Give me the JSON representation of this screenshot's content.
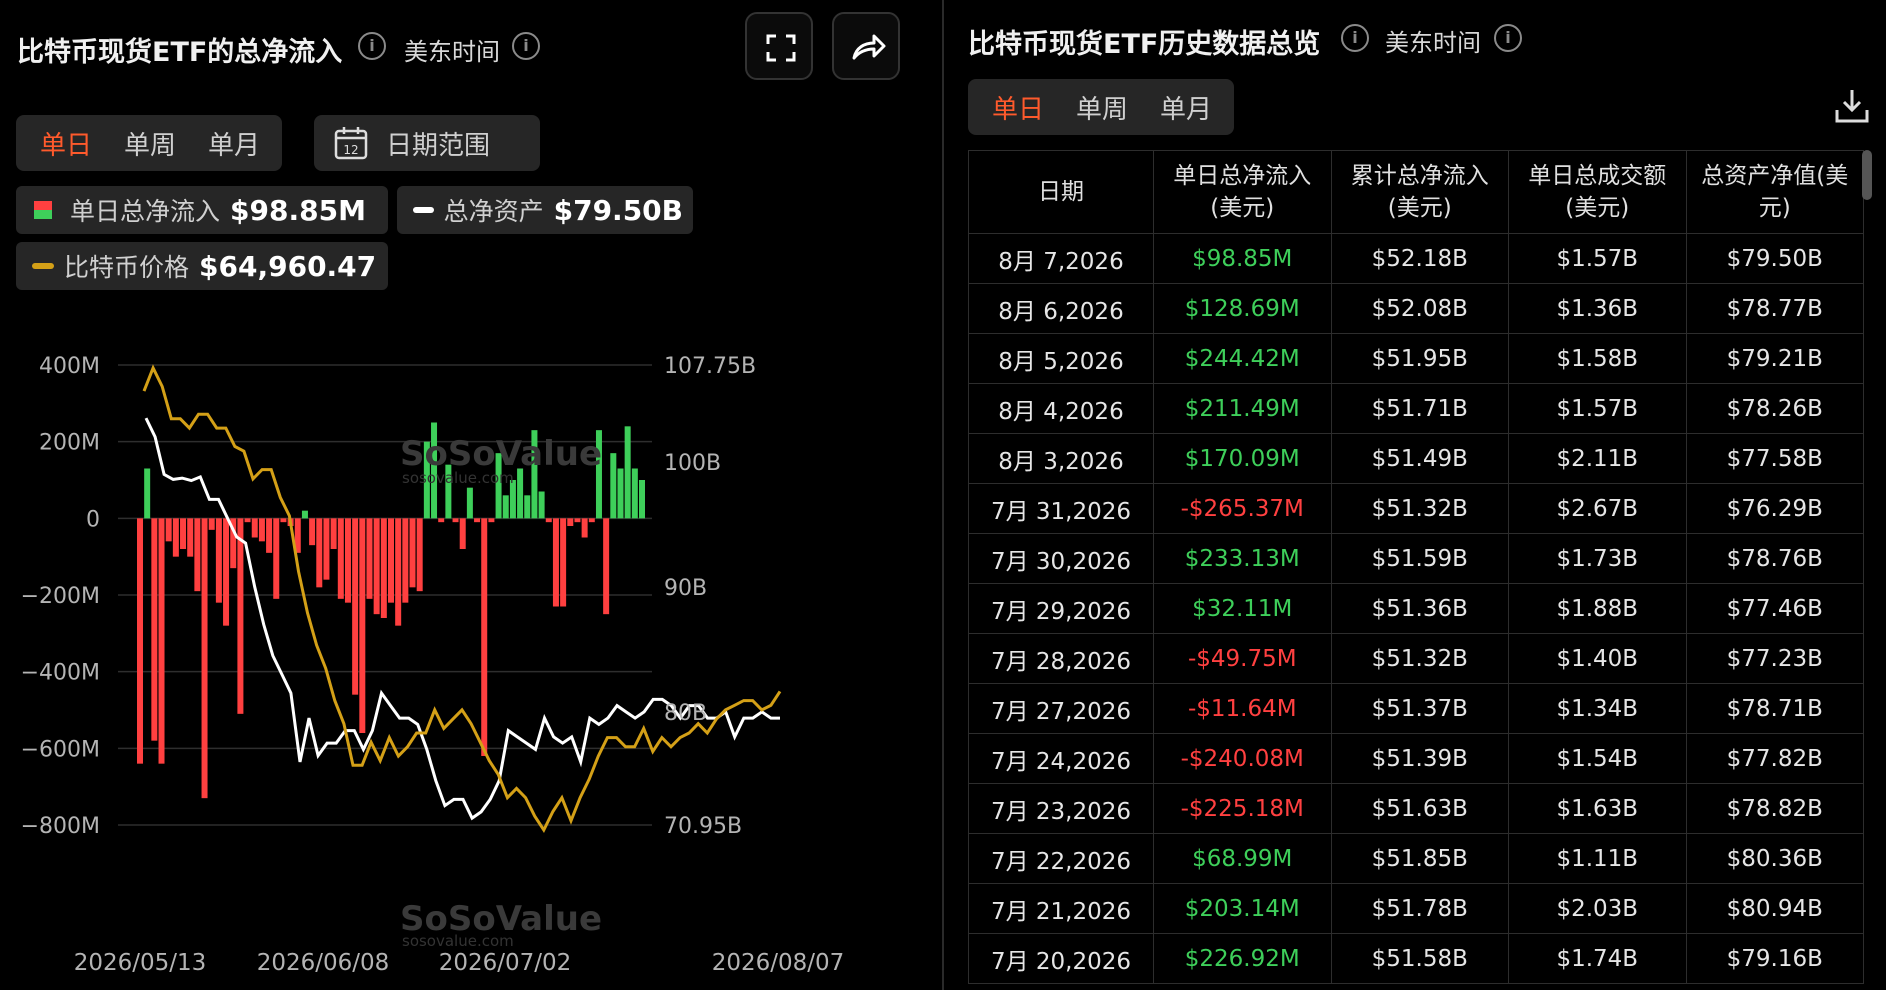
{
  "left": {
    "title": "比特币现货ETF的总净流入",
    "timezone": "美东时间",
    "tabs": [
      "单日",
      "单周",
      "单月"
    ],
    "active_tab": 0,
    "date_range_icon_text": "12",
    "date_range_label": "日期范围",
    "legend": {
      "inflow_label": "单日总净流入",
      "inflow_value": "$98.85M",
      "assets_label": "总净资产",
      "assets_value": "$79.50B",
      "price_label": "比特币价格",
      "price_value": "$64,960.47"
    }
  },
  "right": {
    "title": "比特币现货ETF历史数据总览",
    "timezone": "美东时间",
    "tabs": [
      "单日",
      "单周",
      "单月"
    ],
    "active_tab": 0,
    "table": {
      "headers": [
        "日期",
        "单日总净流入(美元)",
        "累计总净流入(美元)",
        "单日总成交额(美元)",
        "总资产净值(美元)"
      ],
      "rows": [
        [
          "8月 7,2026",
          "$98.85M",
          "$52.18B",
          "$1.57B",
          "$79.50B"
        ],
        [
          "8月 6,2026",
          "$128.69M",
          "$52.08B",
          "$1.36B",
          "$78.77B"
        ],
        [
          "8月 5,2026",
          "$244.42M",
          "$51.95B",
          "$1.58B",
          "$79.21B"
        ],
        [
          "8月 4,2026",
          "$211.49M",
          "$51.71B",
          "$1.57B",
          "$78.26B"
        ],
        [
          "8月 3,2026",
          "$170.09M",
          "$51.49B",
          "$2.11B",
          "$77.58B"
        ],
        [
          "7月 31,2026",
          "-$265.37M",
          "$51.32B",
          "$2.67B",
          "$76.29B"
        ],
        [
          "7月 30,2026",
          "$233.13M",
          "$51.59B",
          "$1.73B",
          "$78.76B"
        ],
        [
          "7月 29,2026",
          "$32.11M",
          "$51.36B",
          "$1.88B",
          "$77.46B"
        ],
        [
          "7月 28,2026",
          "-$49.75M",
          "$51.32B",
          "$1.40B",
          "$77.23B"
        ],
        [
          "7月 27,2026",
          "-$11.64M",
          "$51.37B",
          "$1.34B",
          "$78.71B"
        ],
        [
          "7月 24,2026",
          "-$240.08M",
          "$51.39B",
          "$1.54B",
          "$77.82B"
        ],
        [
          "7月 23,2026",
          "-$225.18M",
          "$51.63B",
          "$1.63B",
          "$78.82B"
        ],
        [
          "7月 22,2026",
          "$68.99M",
          "$51.85B",
          "$1.11B",
          "$80.36B"
        ],
        [
          "7月 21,2026",
          "$203.14M",
          "$51.78B",
          "$2.03B",
          "$80.94B"
        ],
        [
          "7月 20,2026",
          "$226.92M",
          "$51.58B",
          "$1.74B",
          "$79.16B"
        ]
      ]
    }
  },
  "watermark": {
    "brand": "SoSoValue",
    "url": "sosovalue.com"
  },
  "colors": {
    "accent": "#ff5a2c",
    "positive": "#3ecf5a",
    "negative": "#ff4040",
    "price_line": "#d4a017",
    "assets_line": "#ffffff"
  },
  "icons": [
    "info-icon",
    "fullscreen-icon",
    "share-icon",
    "calendar-icon",
    "download-icon"
  ],
  "chart_data": {
    "type": "bar",
    "title": "比特币现货ETF的总净流入",
    "xlabel": "",
    "ylabel": "",
    "x_ticks": [
      "2026/05/13",
      "2026/06/08",
      "2026/07/02",
      "2026/08/07"
    ],
    "y_left_ticks": [
      "400M",
      "200M",
      "0",
      "−200M",
      "−400M",
      "−600M",
      "−800M"
    ],
    "y_left_lim": [
      -800,
      400
    ],
    "y_right_ticks": [
      "107.75B",
      "100B",
      "90B",
      "80B",
      "70.95B"
    ],
    "y_right_lim": [
      70.95,
      107.75
    ],
    "grid": true,
    "series": [
      {
        "name": "单日总净流入",
        "kind": "bar",
        "unit": "M",
        "values": [
          -640,
          130,
          -580,
          -640,
          -60,
          -100,
          -80,
          -100,
          -190,
          -730,
          -30,
          -220,
          -280,
          -130,
          -510,
          -10,
          -50,
          -60,
          -90,
          -210,
          -10,
          -20,
          -90,
          20,
          -70,
          -180,
          -160,
          -80,
          -210,
          -220,
          -460,
          -560,
          -210,
          -250,
          -260,
          -220,
          -280,
          -220,
          -180,
          -190,
          200,
          250,
          -10,
          140,
          -10,
          -80,
          80,
          -10,
          -620,
          -10,
          170,
          60,
          100,
          130,
          60,
          230,
          70,
          -10,
          -230,
          -230,
          -20,
          -10,
          -50,
          -10,
          230,
          -250,
          170,
          130,
          240,
          130,
          100
        ]
      },
      {
        "name": "总净资产",
        "kind": "line",
        "unit": "B",
        "values": [
          103.5,
          102.0,
          99.0,
          98.6,
          98.7,
          98.5,
          98.8,
          97.0,
          97.0,
          95.5,
          94.0,
          93.5,
          90.0,
          87.0,
          84.5,
          83.0,
          81.5,
          76.0,
          79.5,
          76.5,
          77.5,
          77.5,
          78.5,
          78.5,
          77.0,
          78.5,
          81.5,
          80.5,
          79.5,
          79.5,
          79.0,
          77.0,
          74.5,
          72.5,
          73.0,
          73.0,
          71.5,
          72.0,
          73.0,
          74.5,
          78.5,
          78.0,
          77.5,
          77.0,
          79.5,
          78.0,
          77.5,
          78.0,
          76.0,
          79.5,
          79.0,
          79.5,
          80.5,
          80.0,
          79.5,
          80.0,
          81.0,
          81.0,
          80.5,
          79.5,
          80.5,
          80.5,
          79.5,
          79.5,
          80.0,
          78.0,
          79.5,
          79.5,
          80.0,
          79.5,
          79.5
        ]
      },
      {
        "name": "比特币价格",
        "kind": "line",
        "unit": "USD",
        "values": [
          [
            0,
            0.05
          ],
          [
            1,
            0.0
          ],
          [
            2,
            0.04
          ],
          [
            3,
            0.11
          ],
          [
            4,
            0.11
          ],
          [
            5,
            0.13
          ],
          [
            6,
            0.1
          ],
          [
            7,
            0.1
          ],
          [
            8,
            0.13
          ],
          [
            9,
            0.13
          ],
          [
            10,
            0.17
          ],
          [
            11,
            0.18
          ],
          [
            12,
            0.24
          ],
          [
            13,
            0.22
          ],
          [
            14,
            0.22
          ],
          [
            15,
            0.28
          ],
          [
            16,
            0.32
          ],
          [
            17,
            0.44
          ],
          [
            18,
            0.53
          ],
          [
            19,
            0.6
          ],
          [
            20,
            0.65
          ],
          [
            21,
            0.72
          ],
          [
            22,
            0.77
          ],
          [
            23,
            0.86
          ],
          [
            24,
            0.86
          ],
          [
            25,
            0.81
          ],
          [
            26,
            0.85
          ],
          [
            27,
            0.8
          ],
          [
            28,
            0.84
          ],
          [
            29,
            0.82
          ],
          [
            30,
            0.79
          ],
          [
            31,
            0.79
          ],
          [
            32,
            0.74
          ],
          [
            33,
            0.78
          ],
          [
            34,
            0.76
          ],
          [
            35,
            0.74
          ],
          [
            36,
            0.77
          ],
          [
            37,
            0.81
          ],
          [
            38,
            0.85
          ],
          [
            39,
            0.88
          ],
          [
            40,
            0.93
          ],
          [
            41,
            0.91
          ],
          [
            42,
            0.93
          ],
          [
            43,
            0.97
          ],
          [
            44,
            1.0
          ],
          [
            45,
            0.96
          ],
          [
            46,
            0.93
          ],
          [
            47,
            0.98
          ],
          [
            48,
            0.93
          ],
          [
            49,
            0.89
          ],
          [
            50,
            0.84
          ],
          [
            51,
            0.8
          ],
          [
            52,
            0.8
          ],
          [
            53,
            0.82
          ],
          [
            54,
            0.82
          ],
          [
            55,
            0.78
          ],
          [
            56,
            0.83
          ],
          [
            57,
            0.8
          ],
          [
            58,
            0.82
          ],
          [
            59,
            0.8
          ],
          [
            60,
            0.79
          ],
          [
            61,
            0.77
          ],
          [
            62,
            0.79
          ],
          [
            63,
            0.76
          ],
          [
            64,
            0.74
          ],
          [
            65,
            0.73
          ],
          [
            66,
            0.72
          ],
          [
            67,
            0.72
          ],
          [
            68,
            0.74
          ],
          [
            69,
            0.73
          ],
          [
            70,
            0.7
          ]
        ]
      }
    ]
  }
}
